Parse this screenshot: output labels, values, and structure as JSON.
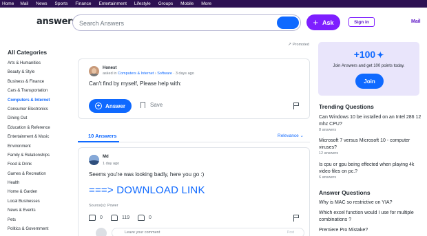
{
  "topnav": [
    "Home",
    "Mail",
    "News",
    "Sports",
    "Finance",
    "Entertainment",
    "Lifestyle",
    "Groups",
    "Mobile",
    "More"
  ],
  "header": {
    "logo": "answers",
    "search_placeholder": "Search Answers",
    "ask_label": "Ask",
    "signin_label": "Sign in",
    "mail_label": "Mail"
  },
  "sidebar": {
    "title": "All Categories",
    "items": [
      {
        "label": "Arts & Humanities",
        "active": false
      },
      {
        "label": "Beauty & Style",
        "active": false
      },
      {
        "label": "Business & Finance",
        "active": false
      },
      {
        "label": "Cars & Transportation",
        "active": false
      },
      {
        "label": "Computers & Internet",
        "active": true
      },
      {
        "label": "Consumer Electronics",
        "active": false
      },
      {
        "label": "Dining Out",
        "active": false
      },
      {
        "label": "Education & Reference",
        "active": false
      },
      {
        "label": "Entertainment & Music",
        "active": false
      },
      {
        "label": "Environment",
        "active": false
      },
      {
        "label": "Family & Relationships",
        "active": false
      },
      {
        "label": "Food & Drink",
        "active": false
      },
      {
        "label": "Games & Recreation",
        "active": false
      },
      {
        "label": "Health",
        "active": false
      },
      {
        "label": "Home & Garden",
        "active": false
      },
      {
        "label": "Local Businesses",
        "active": false
      },
      {
        "label": "News & Events",
        "active": false
      },
      {
        "label": "Pets",
        "active": false
      },
      {
        "label": "Politics & Government",
        "active": false
      }
    ]
  },
  "question": {
    "promoted": "Promoted",
    "user": "Honest",
    "asked_in": "asked in",
    "category": "Computers & Internet",
    "subcategory": "Software",
    "time": "3 days ago",
    "text": "Can't find by myself, Please help with:",
    "answer_label": "Answer",
    "save_label": "Save"
  },
  "answers": {
    "count_label": "10 Answers",
    "sort_label": "Relevance",
    "items": [
      {
        "user": "Md",
        "time": "1 day ago",
        "text": "Seems you're was looking badly, here you go :)",
        "link": "===> DOWNLOAD LINK",
        "source": "Source(s): Power",
        "comments": "0",
        "likes": "119",
        "dislikes": "0",
        "comment_placeholder": "Leave your comment",
        "post_label": "Post"
      }
    ]
  },
  "promo": {
    "points": "+100",
    "text": "Join Answers and get 100 points today.",
    "join_label": "Join"
  },
  "trending": {
    "title": "Trending Questions",
    "items": [
      {
        "q": "Can Windows 10 be installed on an Intel 286 12 mhz CPU?",
        "n": "8 answers"
      },
      {
        "q": "Microsoft 7 versus Microsoft 10 - computer viruses?",
        "n": "12 answers"
      },
      {
        "q": "Is cpu or gpu being effected when playing 4k video files on pc.?",
        "n": "6 answers"
      }
    ]
  },
  "answer_questions": {
    "title": "Answer Questions",
    "items": [
      "Why is MAC so restrictive on YIA?",
      "Which excel function would I use for multiple combinations ?",
      "Premiere Pro Mistake?"
    ]
  },
  "colors": {
    "brand": "#7e1fff",
    "nav": "#2d1152",
    "link": "#0f69ff"
  }
}
